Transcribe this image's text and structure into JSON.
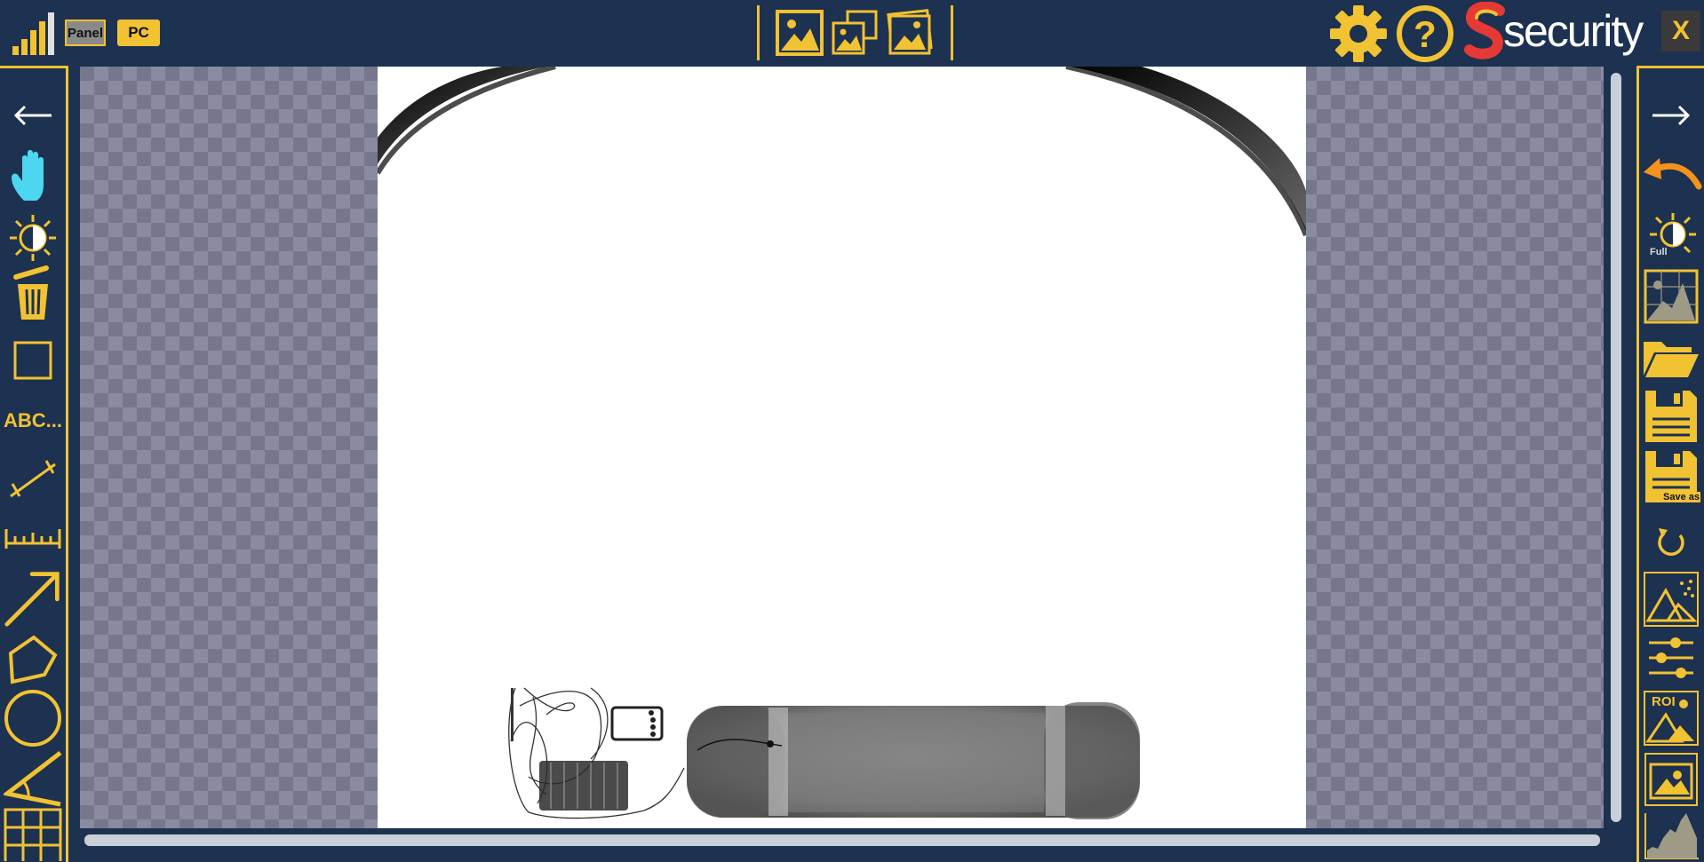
{
  "topbar": {
    "signal_icon": "signal-bars-icon",
    "panel_label": "Panel",
    "pc_label": "PC",
    "image_buttons": [
      "single-image-icon",
      "dual-image-icon",
      "stacked-image-icon"
    ],
    "settings_icon": "gear-icon",
    "help_icon": "help-icon",
    "brand_text": "security",
    "close_label": "X"
  },
  "left_toolbar": [
    {
      "name": "back-arrow-icon"
    },
    {
      "name": "hand-pan-icon"
    },
    {
      "name": "brightness-icon"
    },
    {
      "name": "delete-icon"
    },
    {
      "name": "rectangle-icon"
    },
    {
      "name": "text-tool",
      "label": "ABC..."
    },
    {
      "name": "measure-line-icon"
    },
    {
      "name": "ruler-icon"
    },
    {
      "name": "arrow-tool-icon"
    },
    {
      "name": "polygon-icon"
    },
    {
      "name": "ellipse-icon"
    },
    {
      "name": "angle-icon"
    },
    {
      "name": "grid-icon"
    }
  ],
  "right_toolbar": [
    {
      "name": "forward-arrow-icon"
    },
    {
      "name": "undo-icon"
    },
    {
      "name": "brightness-full-icon",
      "label": "Full"
    },
    {
      "name": "histogram-image-icon"
    },
    {
      "name": "open-folder-icon"
    },
    {
      "name": "save-icon"
    },
    {
      "name": "save-as-icon",
      "label": "Save as"
    },
    {
      "name": "rotate-icon"
    },
    {
      "name": "enhance-image-icon"
    },
    {
      "name": "adjust-sliders-icon"
    },
    {
      "name": "roi-icon",
      "label": "ROI"
    },
    {
      "name": "frame-image-icon"
    },
    {
      "name": "histogram-icon"
    }
  ],
  "colors": {
    "background": "#1d3150",
    "accent": "#f1c232",
    "brand_red": "#e53935",
    "hand_cyan": "#4dd6f0",
    "undo_orange": "#f5921e"
  }
}
